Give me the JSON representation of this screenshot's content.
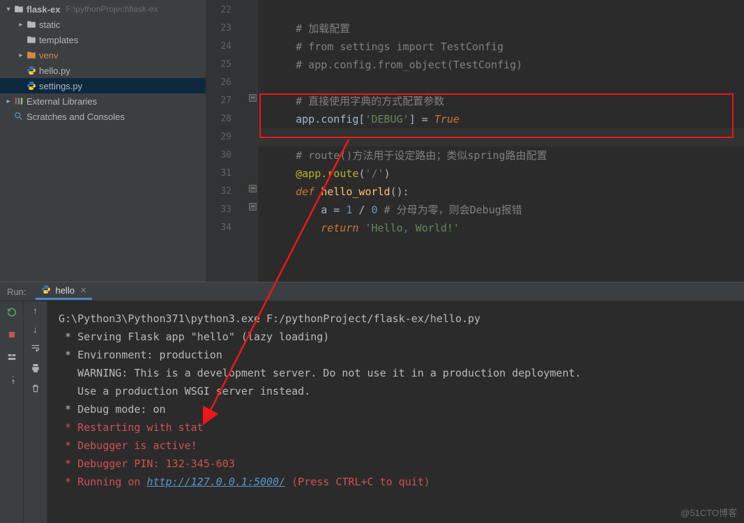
{
  "sidebar": {
    "project": {
      "name": "flask-ex",
      "path": "F:\\pythonProject\\flask-ex"
    },
    "items": [
      {
        "label": "static",
        "kind": "folder",
        "expandable": true
      },
      {
        "label": "templates",
        "kind": "folder",
        "expandable": false
      },
      {
        "label": "venv",
        "kind": "folder",
        "orange": true,
        "expandable": true
      },
      {
        "label": "hello.py",
        "kind": "pyfile"
      },
      {
        "label": "settings.py",
        "kind": "pyfile",
        "selected": true
      }
    ],
    "external": "External Libraries",
    "scratches": "Scratches and Consoles"
  },
  "editor": {
    "first_line_no": 22,
    "lines": [
      {
        "n": 22,
        "text": ""
      },
      {
        "n": 23,
        "text": "    # 加载配置",
        "cls": "comment"
      },
      {
        "n": 24,
        "text": "    # from settings import TestConfig",
        "cls": "comment"
      },
      {
        "n": 25,
        "text": "    # app.config.from_object(TestConfig)",
        "cls": "comment"
      },
      {
        "n": 26,
        "text": ""
      },
      {
        "n": 27,
        "text": "    # 直接使用字典的方式配置参数",
        "cls": "comment"
      },
      {
        "n": 28,
        "tokens": [
          "    ",
          "app.config[",
          "'DEBUG'",
          "] = ",
          "True"
        ],
        "tcls": [
          "",
          "",
          "str",
          "",
          "true"
        ]
      },
      {
        "n": 29,
        "caret": true,
        "text": ""
      },
      {
        "n": 30,
        "text": "    # route()方法用于设定路由；类似spring路由配置",
        "cls": "comment"
      },
      {
        "n": 31,
        "tokens": [
          "    ",
          "@app.route",
          "(",
          "'/'",
          ")"
        ],
        "tcls": [
          "",
          "decor",
          "",
          "str",
          ""
        ]
      },
      {
        "n": 32,
        "tokens": [
          "    ",
          "def ",
          "hello_world",
          "():"
        ],
        "tcls": [
          "",
          "kw",
          "def",
          ""
        ]
      },
      {
        "n": 33,
        "tokens": [
          "        a = ",
          "1",
          " / ",
          "0",
          " # 分母为零，则会Debug报错"
        ],
        "tcls": [
          "",
          "num",
          "",
          "num",
          "comment"
        ]
      },
      {
        "n": 34,
        "tokens": [
          "        ",
          "return ",
          "'Hello, World!'"
        ],
        "tcls": [
          "",
          "kw",
          "str"
        ]
      }
    ]
  },
  "run": {
    "label": "Run:",
    "tab": "hello",
    "console_lines": [
      {
        "text": "G:\\Python3\\Python371\\python3.exe F:/pythonProject/flask-ex/hello.py"
      },
      {
        "text": " * Serving Flask app \"hello\" (lazy loading)"
      },
      {
        "text": " * Environment: production"
      },
      {
        "text": "   WARNING: This is a development server. Do not use it in a production deployment."
      },
      {
        "text": "   Use a production WSGI server instead."
      },
      {
        "text": " * Debug mode: on"
      },
      {
        "text": " * Restarting with stat",
        "red": true
      },
      {
        "text": " * Debugger is active!",
        "red": true
      },
      {
        "text": " * Debugger PIN: 132-345-603",
        "red": true
      },
      {
        "url": "http://127.0.0.1:5000/",
        "prefix": " * Running on ",
        "suffix": " (Press CTRL+C to quit)",
        "red": true
      }
    ]
  },
  "watermark": "@51CTO博客"
}
